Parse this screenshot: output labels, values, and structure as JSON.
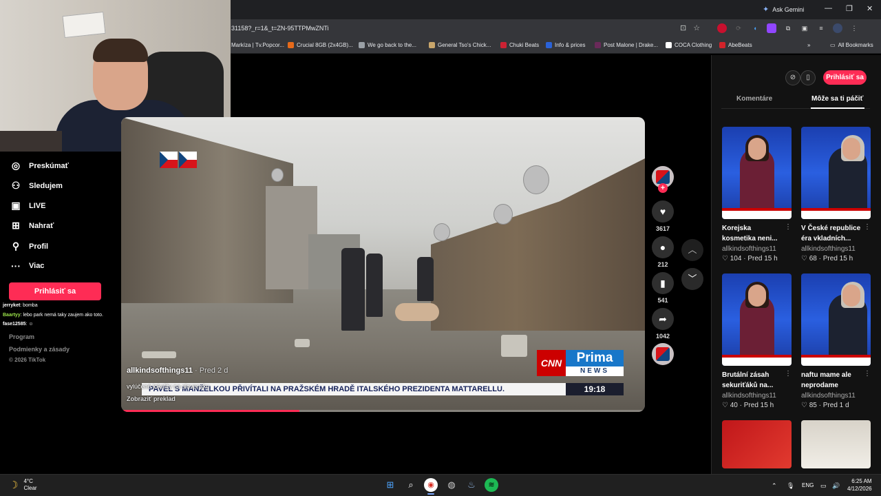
{
  "browser": {
    "ask_gemini": "Ask Gemini",
    "url": "31158?_r=1&_t=ZN-95TTPMwZNTi",
    "bookmarks": [
      {
        "label": "Markíza | Tv.Popcor...",
        "color": "#e8e8e8"
      },
      {
        "label": "Crucial 8GB (2x4GB)...",
        "color": "#e66a1a"
      },
      {
        "label": "We go back to the...",
        "color": "#9aa0a6"
      },
      {
        "label": "General Tso's Chick...",
        "color": "#c9a66b"
      },
      {
        "label": "Chuki Beats",
        "color": "#c23"
      },
      {
        "label": "Info & prices",
        "color": "#2a62d8"
      },
      {
        "label": "Post Malone | Drake...",
        "color": "#6a2a5a"
      },
      {
        "label": "COCA Clothing",
        "color": "#111"
      },
      {
        "label": "AbeBeats",
        "color": "#d2232a"
      }
    ],
    "all_bookmarks": "All Bookmarks"
  },
  "sidebar": {
    "items": [
      {
        "label": "Preskúmať",
        "icon": "compass-icon"
      },
      {
        "label": "Sledujem",
        "icon": "following-icon"
      },
      {
        "label": "LIVE",
        "icon": "live-icon"
      },
      {
        "label": "Nahrať",
        "icon": "upload-icon"
      },
      {
        "label": "Profil",
        "icon": "profile-icon"
      },
      {
        "label": "Viac",
        "icon": "more-icon"
      }
    ],
    "login": "Prihlásiť sa",
    "footer": {
      "program": "Program",
      "terms": "Podmienky a zásady",
      "copyright": "© 2026 TikTok"
    }
  },
  "chat": [
    {
      "user": "jerryket",
      "text": ": bomba",
      "color": "#ffffff"
    },
    {
      "user": "Baartyy",
      "text": ": lebo park nemá taky zaujem ako toto.",
      "color": "#9be34a"
    },
    {
      "user": "fase12585",
      "text": ": ☺",
      "color": "#ffffff"
    }
  ],
  "video": {
    "author": "allkindsofthings11",
    "ago": "· Pred 2 d",
    "caption": "vylúčené lokality na slovensku",
    "translate": "Zobraziť preklad",
    "cnn": "CNN",
    "prima_top": "Prima",
    "prima_bottom": "NEWS",
    "ticker": "PAVEL S MANŽELKOU PŘIVÍTALI NA PRAŽSKÉM HRADĚ ITALSKÉHO PREZIDENTA MATTARELLU.",
    "time": "19:18",
    "progress": 0.34
  },
  "actions": {
    "likes": "3617",
    "comments": "212",
    "saves": "541",
    "shares": "1042"
  },
  "right_panel": {
    "login": "Prihlásiť sa",
    "tabs": [
      "Komentáre",
      "Môže sa ti páčiť"
    ],
    "videos": [
      {
        "title": "Korejska kosmetika neni...",
        "author": "allkindsofthings11",
        "likes": "104",
        "ago": "Pred 15 h"
      },
      {
        "title": "V České republice éra vkladních...",
        "author": "allkindsofthings11",
        "likes": "68",
        "ago": "Pred 15 h"
      },
      {
        "title": "Brutální zásah sekuriťáků na...",
        "author": "allkindsofthings11",
        "likes": "40",
        "ago": "Pred 15 h"
      },
      {
        "title": "naftu mame ale neprodame",
        "author": "allkindsofthings11",
        "likes": "85",
        "ago": "Pred 1 d"
      }
    ]
  },
  "taskbar": {
    "temp": "4°C",
    "weather": "Clear",
    "lang": "ENG",
    "time": "6:25 AM",
    "date": "4/12/2026"
  }
}
